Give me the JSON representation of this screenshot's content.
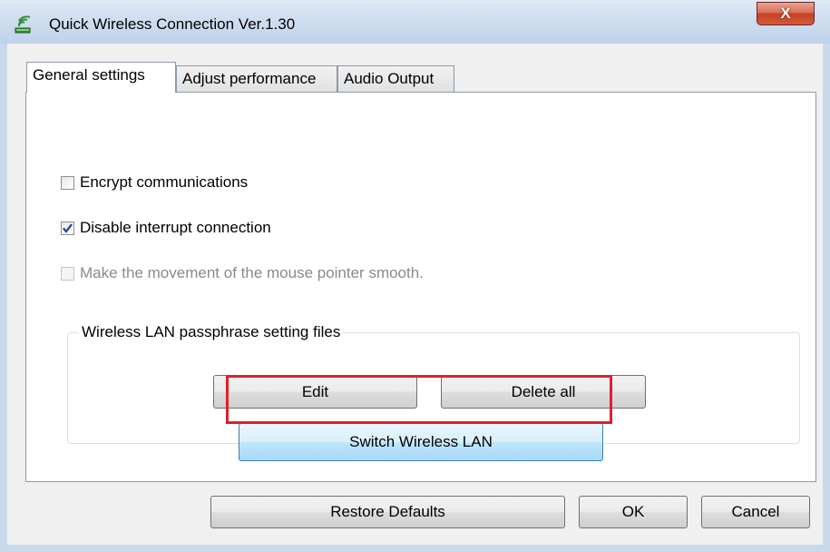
{
  "window": {
    "title": "Quick Wireless Connection Ver.1.30",
    "app_icon": "wireless-signal-icon",
    "close_glyph": "X",
    "close_color": "#c74a2d"
  },
  "tabs": [
    {
      "label": "General settings",
      "selected": true
    },
    {
      "label": "Adjust performance",
      "selected": false
    },
    {
      "label": "Audio Output",
      "selected": false
    }
  ],
  "options": {
    "encrypt": {
      "label": "Encrypt communications",
      "checked": false,
      "enabled": true
    },
    "disable_interrupt": {
      "label": "Disable interrupt connection",
      "checked": true,
      "enabled": true
    },
    "smooth_pointer": {
      "label": "Make the movement of the mouse pointer smooth.",
      "checked": false,
      "enabled": false
    }
  },
  "passphrase_group": {
    "legend": "Wireless LAN passphrase setting files",
    "edit_label": "Edit",
    "delete_all_label": "Delete all"
  },
  "switch_button": {
    "label": "Switch Wireless LAN",
    "highlight_color": "#e0202a"
  },
  "footer": {
    "restore_label": "Restore Defaults",
    "ok_label": "OK",
    "cancel_label": "Cancel"
  }
}
